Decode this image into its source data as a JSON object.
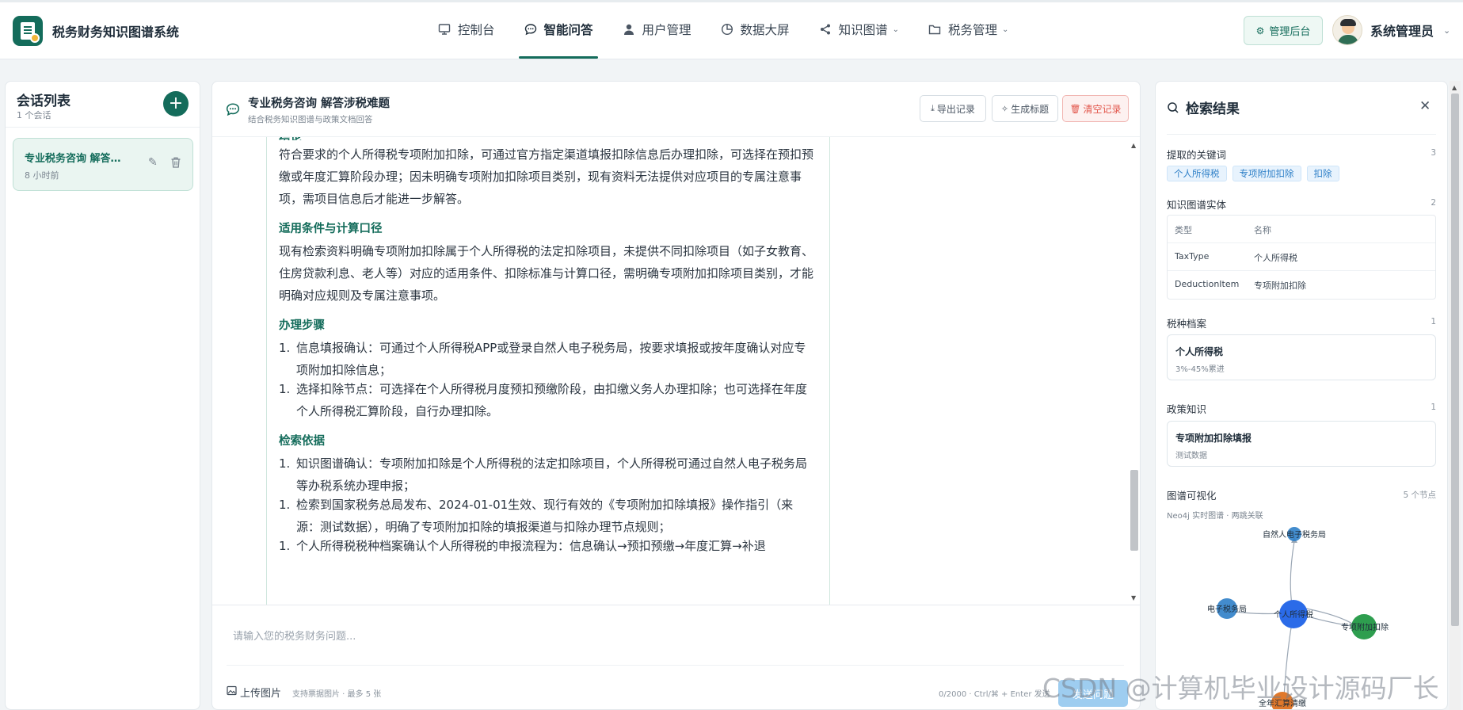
{
  "app": {
    "title": "税务财务知识图谱系统"
  },
  "nav": {
    "items": [
      {
        "label": "控制台",
        "icon": "monitor-icon"
      },
      {
        "label": "智能问答",
        "icon": "chat-icon"
      },
      {
        "label": "用户管理",
        "icon": "user-icon"
      },
      {
        "label": "数据大屏",
        "icon": "pie-chart-icon"
      },
      {
        "label": "知识图谱",
        "icon": "share-icon"
      },
      {
        "label": "税务管理",
        "icon": "folder-icon"
      }
    ],
    "active": "智能问答"
  },
  "header": {
    "admin_label": "管理后台",
    "user_name": "系统管理员"
  },
  "sessions": {
    "title": "会话列表",
    "count": "1 个会话",
    "items": [
      {
        "title": "专业税务咨询 解答涉税难题",
        "time": "8 小时前"
      }
    ]
  },
  "chat": {
    "title": "专业税务咨询 解答涉税难题",
    "subtitle": "结合税务知识图谱与政策文档回答",
    "buttons": {
      "export": "导出记录",
      "gen_title": "生成标题",
      "clear": "清空记录"
    },
    "message": {
      "conclusion_heading": "结论",
      "conclusion": "符合要求的个人所得税专项附加扣除，可通过官方指定渠道填报扣除信息后办理扣除，可选择在预扣预缴或年度汇算阶段办理；因未明确专项附加扣除项目类别，现有资料无法提供对应项目的专属注意事项，需项目信息后才能进一步解答。",
      "conditions_heading": "适用条件与计算口径",
      "conditions": "现有检索资料明确专项附加扣除属于个人所得税的法定扣除项目，未提供不同扣除项目（如子女教育、住房贷款利息、老人等）对应的适用条件、扣除标准与计算口径，需明确专项附加扣除项目类别，才能明确对应规则及专属注意事项。",
      "steps_heading": "办理步骤",
      "steps": [
        "信息填报确认：可通过个人所得税APP或登录自然人电子税务局，按要求填报或按年度确认对应专项附加扣除信息；",
        "选择扣除节点：可选择在个人所得税月度预扣预缴阶段，由扣缴义务人办理扣除；也可选择在年度个人所得税汇算阶段，自行办理扣除。"
      ],
      "basis_heading": "检索依据",
      "basis": [
        "知识图谱确认：专项附加扣除是个人所得税的法定扣除项目，个人所得税可通过自然人电子税务局等办税系统办理申报；",
        "检索到国家税务总局发布、2024-01-01生效、现行有效的《专项附加扣除填报》操作指引（来源：测试数据），明确了专项附加扣除的填报渠道与扣除办理节点规则；",
        "个人所得税税种档案确认个人所得税的申报流程为：信息确认→预扣预缴→年度汇算→补退"
      ]
    },
    "input_placeholder": "请输入您的税务财务问题...",
    "upload_label": "上传图片",
    "upload_hint": "支持票据图片 · 最多 5 张",
    "counter": "0/2000 · Ctrl/⌘ + Enter 发送",
    "send_label": "发送问题"
  },
  "results": {
    "title": "检索结果",
    "keywords": {
      "label": "提取的关键词",
      "count": "3",
      "items": [
        "个人所得税",
        "专项附加扣除",
        "扣除"
      ]
    },
    "entities": {
      "label": "知识图谱实体",
      "count": "2",
      "header": [
        "类型",
        "名称"
      ],
      "rows": [
        [
          "TaxType",
          "个人所得税"
        ],
        [
          "DeductionItem",
          "专项附加扣除"
        ]
      ]
    },
    "tax_archive": {
      "label": "税种档案",
      "count": "1",
      "title": "个人所得税",
      "sub": "3%-45%累进"
    },
    "policy": {
      "label": "政策知识",
      "count": "1",
      "title": "专项附加扣除填报",
      "sub": "测试数据"
    },
    "graph": {
      "label": "图谱可视化",
      "count": "5 个节点",
      "sub": "Neo4j 实时图谱 · 两跳关联",
      "nodes": [
        {
          "label": "自然人电子税务局",
          "color": "#2f80c8"
        },
        {
          "label": "电子税务局",
          "color": "#2f80c8"
        },
        {
          "label": "个人所得税",
          "color": "#2b6be8"
        },
        {
          "label": "专项附加扣除",
          "color": "#2e9e4f"
        },
        {
          "label": "全年汇算清缴",
          "color": "#e0782b"
        }
      ]
    }
  },
  "watermark": "CSDN @计算机毕业设计源码厂长"
}
